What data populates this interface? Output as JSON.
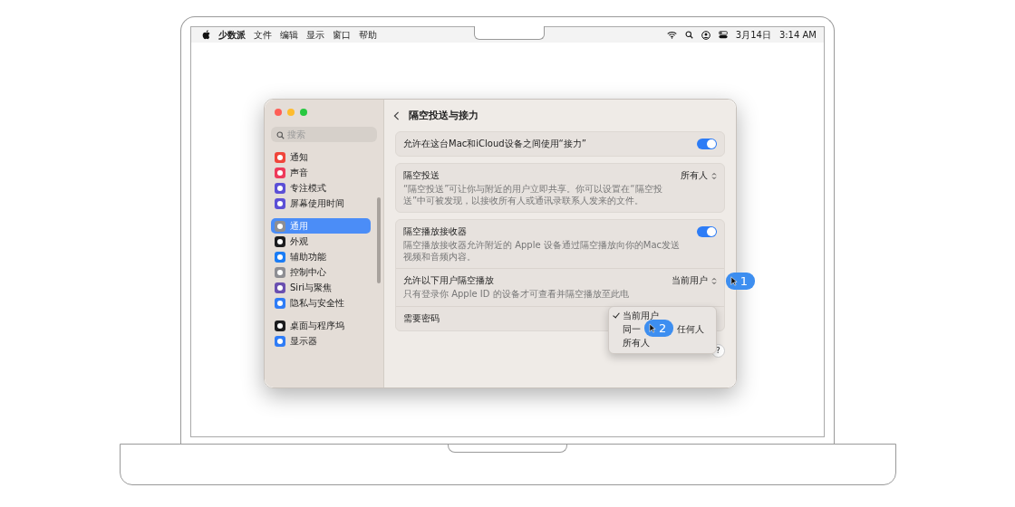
{
  "menu_bar": {
    "menus": [
      "少数派",
      "文件",
      "编辑",
      "显示",
      "窗口",
      "帮助"
    ],
    "date": "3月14日",
    "time": "3:14 AM"
  },
  "window": {
    "search": {
      "placeholder": "搜索"
    },
    "sidebar": {
      "groups": [
        {
          "items": [
            {
              "label": "通知",
              "selected": false,
              "color": "#f0453a"
            },
            {
              "label": "声音",
              "selected": false,
              "color": "#ee3a5a"
            },
            {
              "label": "专注模式",
              "selected": false,
              "color": "#5b4fd6"
            },
            {
              "label": "屏幕使用时间",
              "selected": false,
              "color": "#5b4fd6"
            }
          ]
        },
        {
          "items": [
            {
              "label": "通用",
              "selected": true,
              "color": "#8e8e93"
            },
            {
              "label": "外观",
              "selected": false,
              "color": "#1c1c1e"
            },
            {
              "label": "辅助功能",
              "selected": false,
              "color": "#1a7cf5"
            },
            {
              "label": "控制中心",
              "selected": false,
              "color": "#8e8e93"
            },
            {
              "label": "Siri与聚焦",
              "selected": false,
              "color": "#6a4fb0"
            },
            {
              "label": "隐私与安全性",
              "selected": false,
              "color": "#2f7cf6"
            }
          ]
        },
        {
          "items": [
            {
              "label": "桌面与程序坞",
              "selected": false,
              "color": "#1c1c1e"
            },
            {
              "label": "显示器",
              "selected": false,
              "color": "#2f7cf6"
            }
          ]
        }
      ]
    },
    "title": "隔空投送与接力",
    "sections": [
      {
        "rows": [
          {
            "kind": "toggle",
            "label": "允许在这台Mac和iCloud设备之间使用“接力”",
            "on": true
          }
        ]
      },
      {
        "rows": [
          {
            "kind": "popup",
            "label": "隔空投送",
            "description": "“隔空投送”可让你与附近的用户立即共享。你可以设置在“隔空投送”中可被发现，以接收所有人或通讯录联系人发来的文件。",
            "value": "所有人"
          }
        ]
      },
      {
        "rows": [
          {
            "kind": "toggle",
            "label": "隔空播放接收器",
            "description": "隔空播放接收器允许附近的 Apple 设备通过隔空播放向你的Mac发送视频和音频内容。",
            "on": true
          },
          {
            "kind": "popup_open",
            "label": "允许以下用户隔空播放",
            "description": "只有登录你 Apple ID 的设备才可查看并隔空播放至此电",
            "value": "当前用户"
          },
          {
            "kind": "plain",
            "label": "需要密码"
          }
        ]
      }
    ],
    "popup_menu": [
      {
        "label": "当前用户",
        "selected": true
      },
      {
        "label": "同一",
        "label_end": "任何人",
        "selected": false
      },
      {
        "label": "所有人",
        "selected": false
      }
    ],
    "help": "?"
  },
  "callouts": [
    "1",
    "2"
  ]
}
